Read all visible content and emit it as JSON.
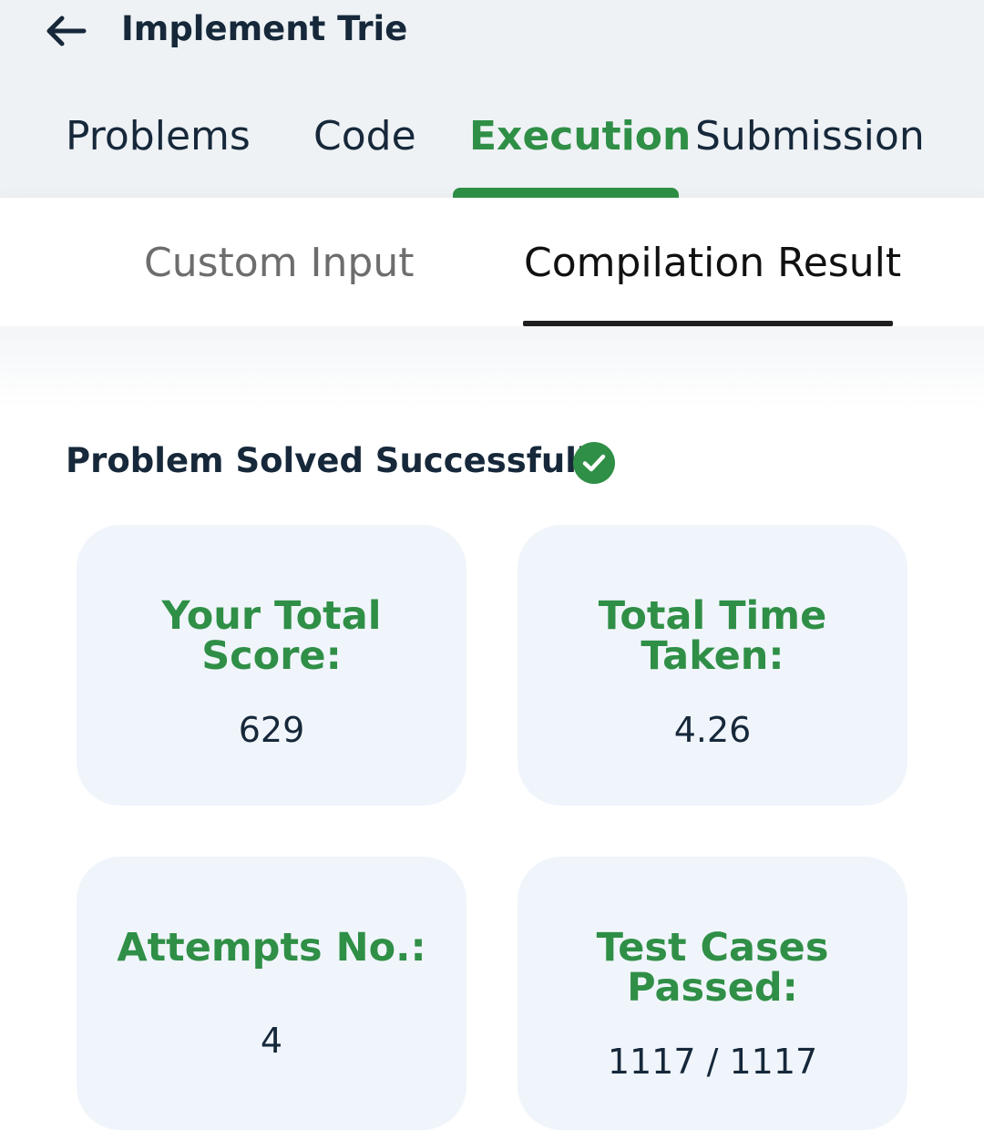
{
  "header": {
    "title": "Implement Trie",
    "back_icon": "arrow-left-icon"
  },
  "main_tabs": [
    {
      "label": "Problems",
      "active": false
    },
    {
      "label": "Code",
      "active": false
    },
    {
      "label": "Execution",
      "active": true
    },
    {
      "label": "Submission",
      "active": false
    }
  ],
  "sub_tabs": [
    {
      "label": "Custom Input",
      "active": false
    },
    {
      "label": "Compilation Result",
      "active": true
    }
  ],
  "result": {
    "status_text": "Problem Solved Successfully",
    "status_icon": "check-circle-icon",
    "cards": [
      {
        "label_line1": "Your Total",
        "label_line2": "Score:",
        "value": "629"
      },
      {
        "label_line1": "Total Time",
        "label_line2": "Taken:",
        "value": "4.26"
      },
      {
        "label_line1": "Attempts No.:",
        "value": "4"
      },
      {
        "label_line1": "Test Cases",
        "label_line2": "Passed:",
        "value": "1117 / 1117"
      }
    ]
  },
  "colors": {
    "header_bg": "#eef2f5",
    "accent_green": "#2f8f46",
    "text_dark": "#16283a",
    "card_bg": "#f0f5fc"
  }
}
